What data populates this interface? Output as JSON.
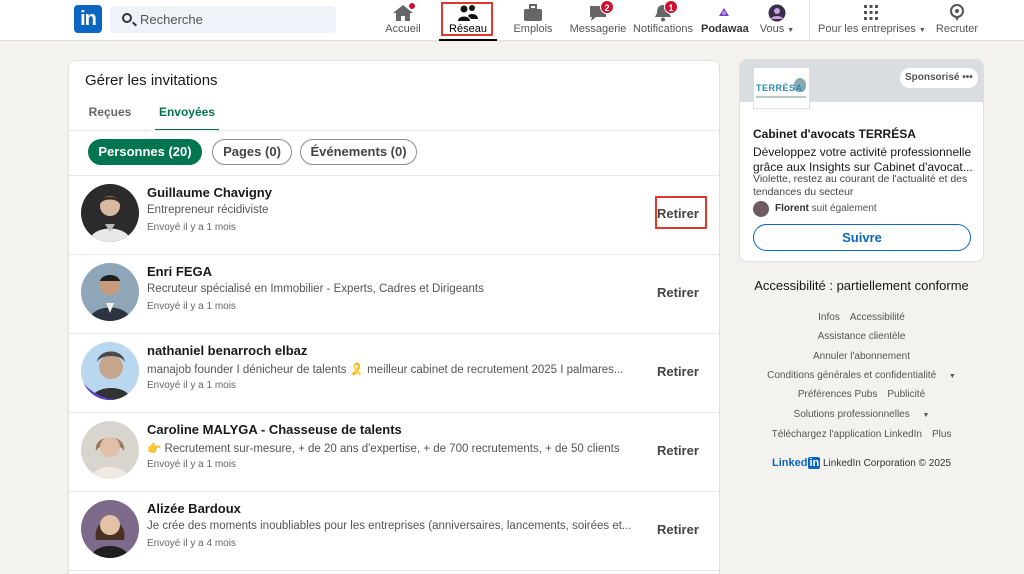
{
  "nav": {
    "logo": "in",
    "search_placeholder": "Recherche",
    "items": [
      {
        "label": "Accueil"
      },
      {
        "label": "Réseau"
      },
      {
        "label": "Emplois"
      },
      {
        "label": "Messagerie",
        "badge": "2"
      },
      {
        "label": "Notifications",
        "badge": "1"
      },
      {
        "label": "Podawaa"
      },
      {
        "label": "Vous"
      },
      {
        "label": "Pour les entreprises"
      },
      {
        "label": "Recruter"
      }
    ]
  },
  "main": {
    "title": "Gérer les invitations",
    "tabs": [
      {
        "label": "Reçues"
      },
      {
        "label": "Envoyées"
      }
    ],
    "filters": [
      {
        "label": "Personnes (20)"
      },
      {
        "label": "Pages (0)"
      },
      {
        "label": "Événements (0)"
      }
    ],
    "invitations": [
      {
        "name": "Guillaume Chavigny",
        "headline": "Entrepreneur récidiviste",
        "time": "Envoyé il y a 1 mois",
        "action": "Retirer"
      },
      {
        "name": "Enri FEGA",
        "headline": "Recruteur spécialisé en Immobilier - Experts, Cadres et Dirigeants",
        "time": "Envoyé il y a 1 mois",
        "action": "Retirer"
      },
      {
        "name": "nathaniel benarroch elbaz",
        "headline": "manajob founder I dénicheur de talents 🎗️ meilleur cabinet de recrutement 2025 I palmares...",
        "time": "Envoyé il y a 1 mois",
        "action": "Retirer"
      },
      {
        "name": "Caroline MALYGA - Chasseuse de talents",
        "headline": "👉 Recrutement sur-mesure, + de 20 ans d'expertise, + de 700 recrutements, + de 50 clients",
        "time": "Envoyé il y a 1 mois",
        "action": "Retirer"
      },
      {
        "name": "Alizée Bardoux",
        "headline": "Je crée des moments inoubliables pour les entreprises (anniversaires, lancements, soirées et...",
        "time": "Envoyé il y a 4 mois",
        "action": "Retirer"
      }
    ]
  },
  "ad": {
    "logo_text": "TERRÉSA",
    "sponsored": "Sponsorisé",
    "more": "•••",
    "title": "Cabinet d'avocats TERRÉSA",
    "description": "Développez votre activité professionnelle grâce aux Insights sur Cabinet d'avocat...",
    "sub": "Violette, restez au courant de l'actualité et des tendances du secteur",
    "social_name": "Florent",
    "social_text": "suit également",
    "follow": "Suivre"
  },
  "sidebar": {
    "accessibility": "Accessibilité : partiellement conforme",
    "footer": {
      "l1a": "Infos",
      "l1b": "Accessibilité",
      "l2": "Assistance clientèle",
      "l3": "Annuler l'abonnement",
      "l4": "Conditions générales et confidentialité",
      "l5a": "Préférences Pubs",
      "l5b": "Publicité",
      "l6": "Solutions professionnelles",
      "l7a": "Téléchargez l'application LinkedIn",
      "l7b": "Plus",
      "brand_a": "Linked",
      "brand_b": "in",
      "copyright": "LinkedIn Corporation © 2025"
    }
  },
  "colors": {
    "accent_green": "#01754f",
    "linkedin_blue": "#0a66c2",
    "highlight_red": "#e0372a"
  }
}
